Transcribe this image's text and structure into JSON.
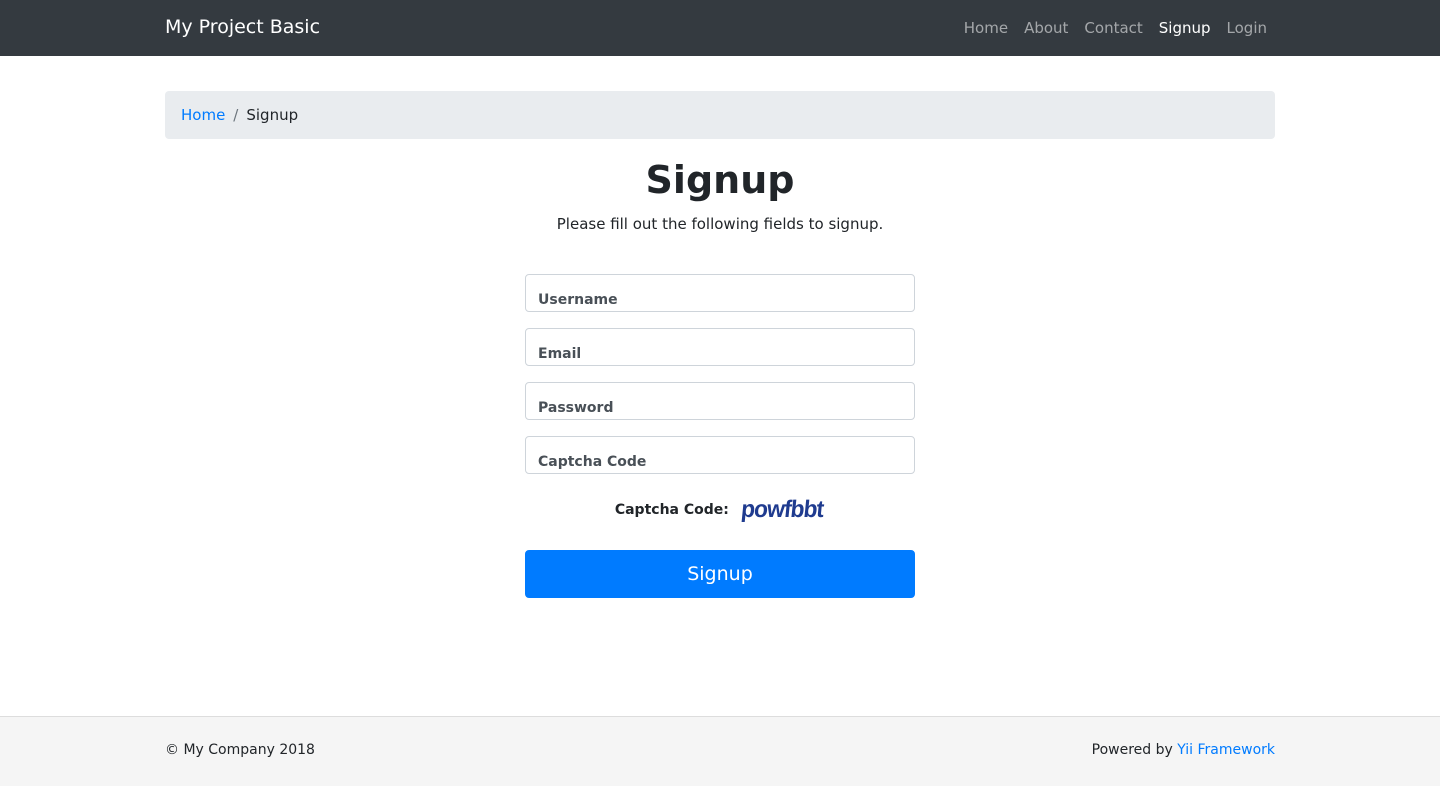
{
  "navbar": {
    "brand": "My Project Basic",
    "items": [
      {
        "label": "Home",
        "active": false
      },
      {
        "label": "About",
        "active": false
      },
      {
        "label": "Contact",
        "active": false
      },
      {
        "label": "Signup",
        "active": true
      },
      {
        "label": "Login",
        "active": false
      }
    ]
  },
  "breadcrumb": {
    "home": "Home",
    "separator": "/",
    "current": "Signup"
  },
  "main": {
    "title": "Signup",
    "subtitle": "Please fill out the following fields to signup."
  },
  "form": {
    "username_placeholder": "Username",
    "email_placeholder": "Email",
    "password_placeholder": "Password",
    "captcha_placeholder": "Captcha Code",
    "captcha_label": "Captcha Code:",
    "captcha_text": "powfbbt",
    "submit_label": "Signup"
  },
  "footer": {
    "copyright": "© My Company 2018",
    "powered_prefix": "Powered by ",
    "powered_link": "Yii Framework"
  },
  "colors": {
    "navbar_bg": "#343a40",
    "primary": "#007bff",
    "breadcrumb_bg": "#e9ecef",
    "footer_bg": "#f5f5f5"
  }
}
